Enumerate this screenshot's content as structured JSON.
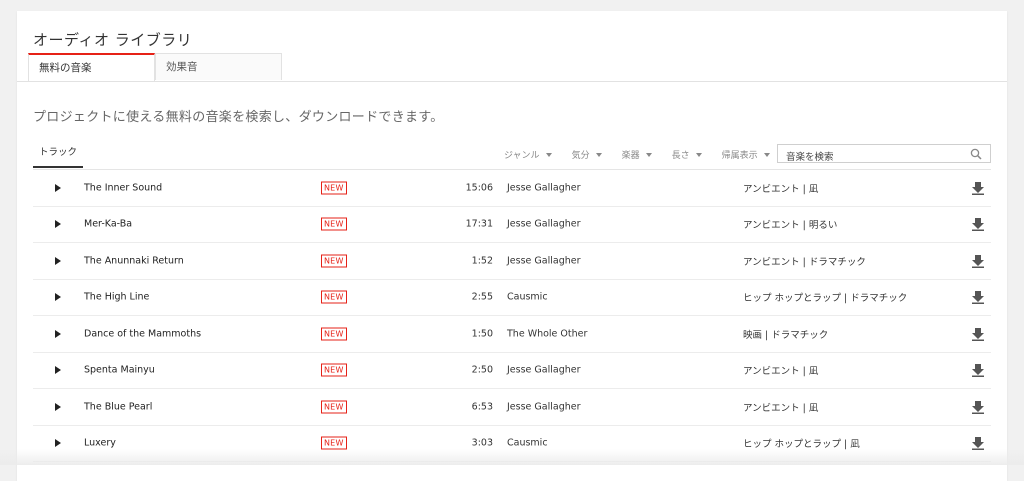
{
  "library_title": "オーディオ ライブラリ",
  "tabs": [
    {
      "label": "無料の音楽",
      "active": true
    },
    {
      "label": "効果音",
      "active": false
    }
  ],
  "description": "プロジェクトに使える無料の音楽を検索し、ダウンロードできます。",
  "filters": {
    "track_tab": "トラック",
    "items": [
      {
        "label": "ジャンル"
      },
      {
        "label": "気分"
      },
      {
        "label": "楽器"
      },
      {
        "label": "長さ"
      },
      {
        "label": "帰属表示"
      }
    ]
  },
  "search": {
    "placeholder": "音楽を検索",
    "value": ""
  },
  "colors": {
    "accent": "#e62117"
  },
  "tracks": [
    {
      "title": "The Inner Sound",
      "badge": "NEW",
      "duration": "15:06",
      "artist": "Jesse Gallagher",
      "genre": "アンビエント | 凪"
    },
    {
      "title": "Mer-Ka-Ba",
      "badge": "NEW",
      "duration": "17:31",
      "artist": "Jesse Gallagher",
      "genre": "アンビエント | 明るい"
    },
    {
      "title": "The Anunnaki Return",
      "badge": "NEW",
      "duration": "1:52",
      "artist": "Jesse Gallagher",
      "genre": "アンビエント | ドラマチック"
    },
    {
      "title": "The High Line",
      "badge": "NEW",
      "duration": "2:55",
      "artist": "Causmic",
      "genre": "ヒップ ホップとラップ | ドラマチック"
    },
    {
      "title": "Dance of the Mammoths",
      "badge": "NEW",
      "duration": "1:50",
      "artist": "The Whole Other",
      "genre": "映画 | ドラマチック"
    },
    {
      "title": "Spenta Mainyu",
      "badge": "NEW",
      "duration": "2:50",
      "artist": "Jesse Gallagher",
      "genre": "アンビエント | 凪"
    },
    {
      "title": "The Blue Pearl",
      "badge": "NEW",
      "duration": "6:53",
      "artist": "Jesse Gallagher",
      "genre": "アンビエント | 凪"
    },
    {
      "title": "Luxery",
      "badge": "NEW",
      "duration": "3:03",
      "artist": "Causmic",
      "genre": "ヒップ ホップとラップ | 凪"
    }
  ]
}
